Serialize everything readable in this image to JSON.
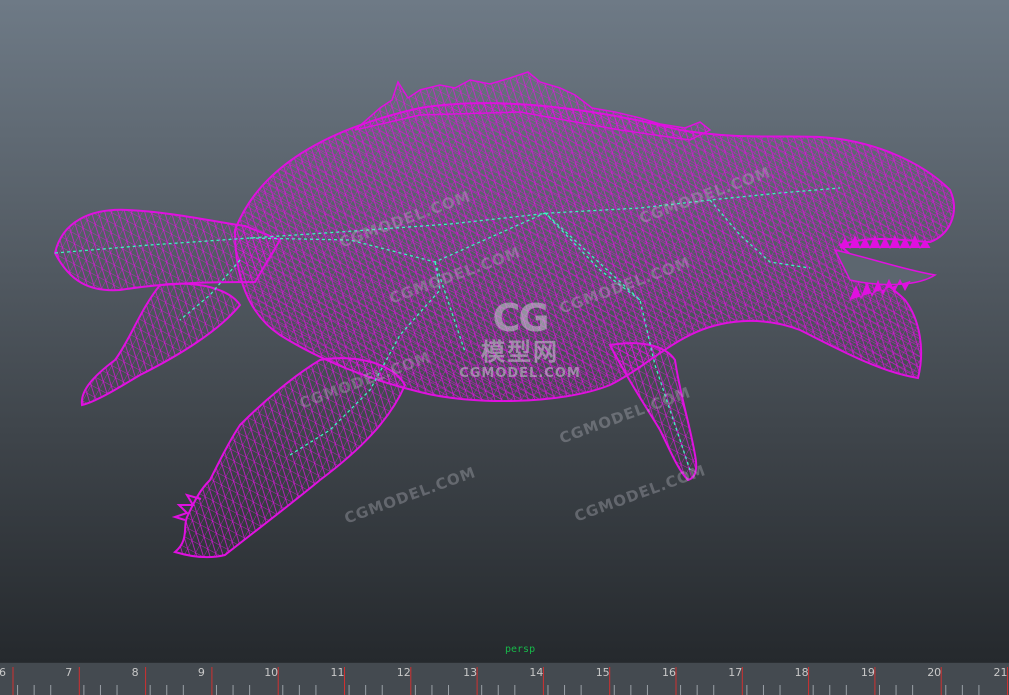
{
  "viewport": {
    "camera": "persp",
    "wireframe_color": "#e010e0",
    "joint_color": "#40f0c0",
    "background_top": "#6e7a86",
    "background_bottom": "#25292d"
  },
  "watermarks": {
    "text": "CGMODEL.COM",
    "logo_mark": "CG",
    "logo_cn": "模型网",
    "logo_en": "CGMODEL.COM"
  },
  "timeline": {
    "frames": [
      "6",
      "7",
      "8",
      "9",
      "10",
      "11",
      "12",
      "13",
      "14",
      "15",
      "16",
      "17",
      "18",
      "19",
      "20",
      "21"
    ],
    "tick_color": "#d03030"
  }
}
